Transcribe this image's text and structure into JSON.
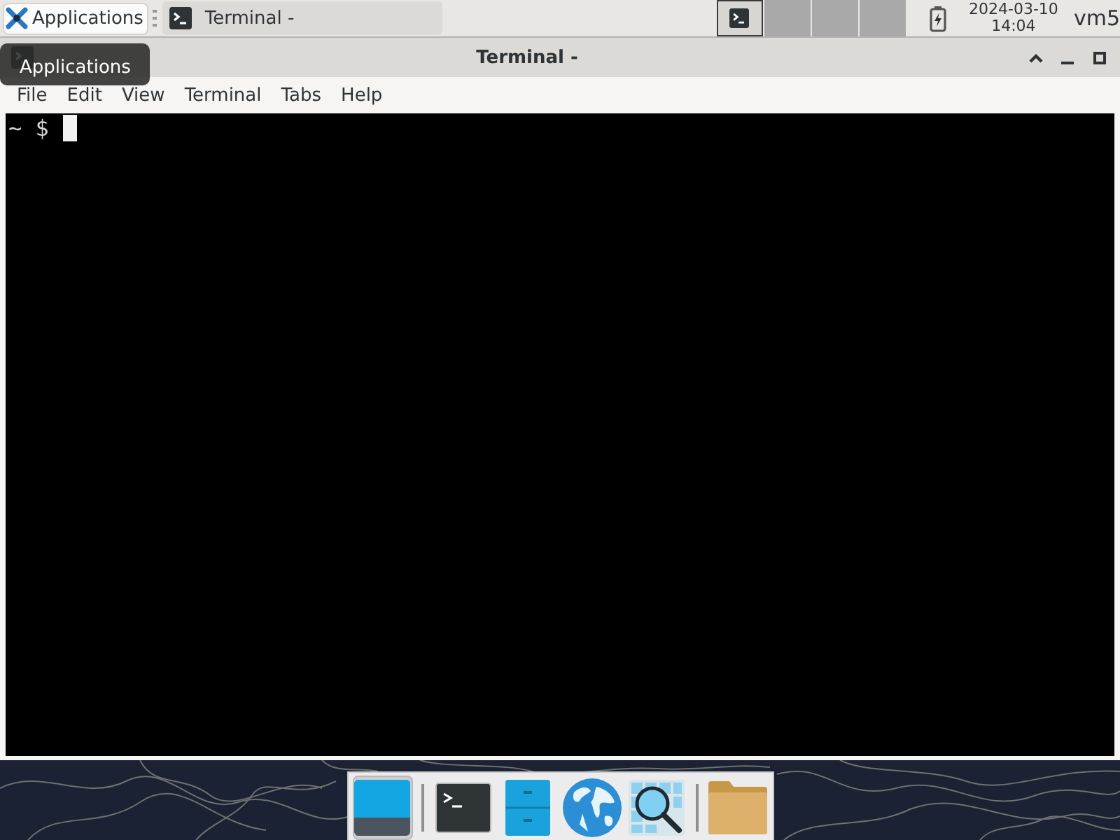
{
  "top_panel": {
    "applications_button": {
      "label": "Applications"
    },
    "tasks": [
      {
        "label": "Terminal -",
        "selected": true
      }
    ],
    "workspaces": [
      {
        "selected": true,
        "occupied": true
      },
      {
        "selected": false,
        "occupied": false
      },
      {
        "selected": false,
        "occupied": false
      },
      {
        "selected": false,
        "occupied": false
      }
    ],
    "clock": {
      "date": "2024-03-10",
      "time": "14:04"
    },
    "user": "vm5"
  },
  "tooltip": {
    "text": "Applications"
  },
  "window": {
    "title": "Terminal -",
    "menu": [
      "File",
      "Edit",
      "View",
      "Terminal",
      "Tabs",
      "Help"
    ],
    "prompt": "~ $"
  },
  "dock": {
    "groups": [
      {
        "items": [
          {
            "kind": "show-desktop",
            "selected": true
          }
        ]
      },
      {
        "items": [
          {
            "kind": "terminal",
            "selected": false
          },
          {
            "kind": "file-manager",
            "selected": false
          },
          {
            "kind": "browser",
            "selected": false
          },
          {
            "kind": "app-finder",
            "selected": false
          }
        ]
      },
      {
        "items": [
          {
            "kind": "folder",
            "selected": false
          }
        ]
      }
    ]
  }
}
